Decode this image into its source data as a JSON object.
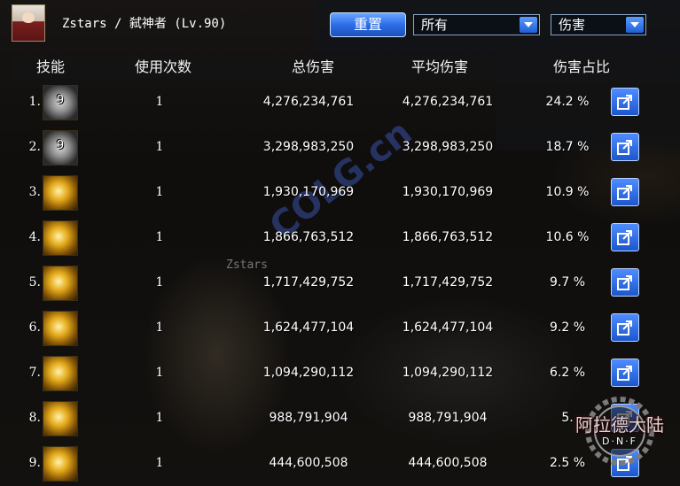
{
  "character": {
    "title": "Zstars / 弑神者 (Lv.90)"
  },
  "controls": {
    "reset_label": "重置",
    "filter_select": "所有",
    "metric_select": "伤害"
  },
  "table": {
    "headers": [
      "技能",
      "使用次数",
      "总伤害",
      "平均伤害",
      "伤害占比"
    ],
    "rows": [
      {
        "rank": "1.",
        "icon": "skill-icon-grey-level",
        "icon_level": "9",
        "uses": "1",
        "total": "4,276,234,761",
        "avg": "4,276,234,761",
        "pct": "24.2 %"
      },
      {
        "rank": "2.",
        "icon": "skill-icon-grey-level",
        "icon_level": "9",
        "uses": "1",
        "total": "3,298,983,250",
        "avg": "3,298,983,250",
        "pct": "18.7 %"
      },
      {
        "rank": "3.",
        "icon": "skill-icon-gold",
        "icon_level": "",
        "uses": "1",
        "total": "1,930,170,969",
        "avg": "1,930,170,969",
        "pct": "10.9 %"
      },
      {
        "rank": "4.",
        "icon": "skill-icon-gold",
        "icon_level": "",
        "uses": "1",
        "total": "1,866,763,512",
        "avg": "1,866,763,512",
        "pct": "10.6 %"
      },
      {
        "rank": "5.",
        "icon": "skill-icon-gold",
        "icon_level": "",
        "uses": "1",
        "total": "1,717,429,752",
        "avg": "1,717,429,752",
        "pct": "9.7 %"
      },
      {
        "rank": "6.",
        "icon": "skill-icon-gold",
        "icon_level": "",
        "uses": "1",
        "total": "1,624,477,104",
        "avg": "1,624,477,104",
        "pct": "9.2 %"
      },
      {
        "rank": "7.",
        "icon": "skill-icon-gold",
        "icon_level": "",
        "uses": "1",
        "total": "1,094,290,112",
        "avg": "1,094,290,112",
        "pct": "6.2 %"
      },
      {
        "rank": "8.",
        "icon": "skill-icon-gold",
        "icon_level": "",
        "uses": "1",
        "total": "988,791,904",
        "avg": "988,791,904",
        "pct": "5."
      },
      {
        "rank": "9.",
        "icon": "skill-icon-gold",
        "icon_level": "",
        "uses": "1",
        "total": "444,600,508",
        "avg": "444,600,508",
        "pct": "2.5 %"
      }
    ]
  },
  "overlay": {
    "player_name": "Zstars",
    "watermark": "COLG.cn",
    "logo_text": "阿拉德大陆",
    "logo_sub": "D·N·F"
  },
  "colors": {
    "button_blue": "#2d6ee8",
    "text_white": "#ffffff",
    "skill_gold": "#e3a81a"
  }
}
